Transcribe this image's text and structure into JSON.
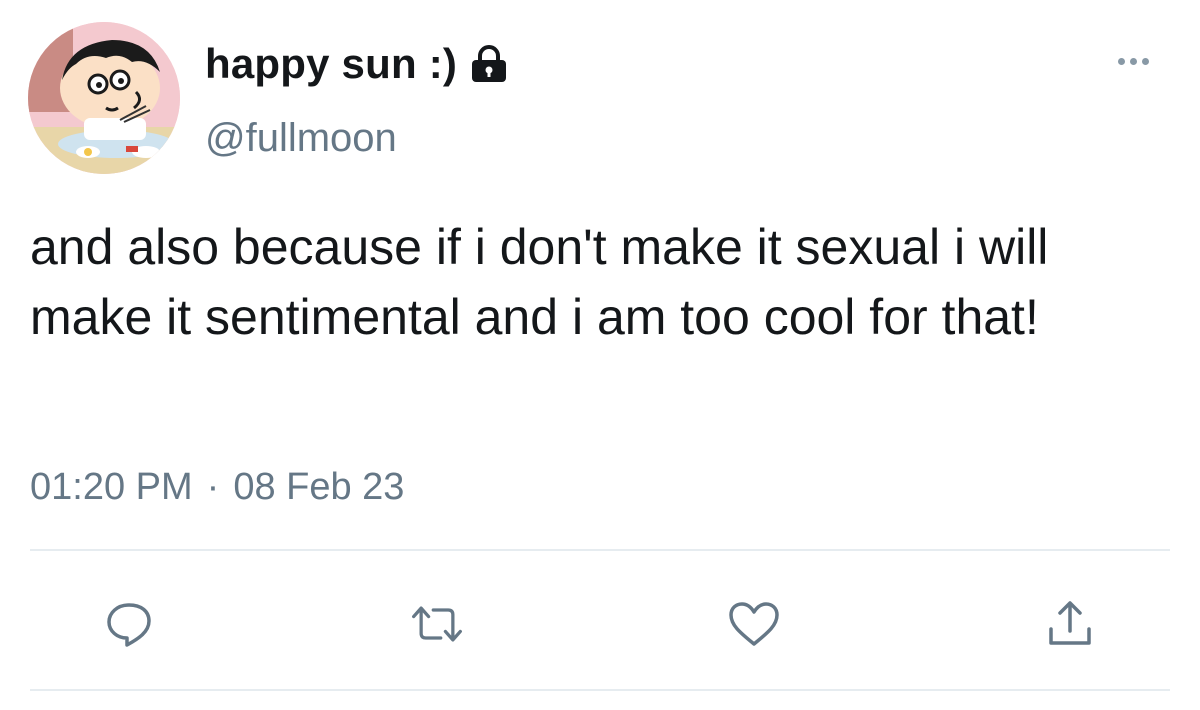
{
  "tweet": {
    "display_name": "happy sun :)",
    "handle": "@fullmoon",
    "text": "and also because if i don't make it sexual i will make it sentimental and i am too cool for that!",
    "time": "01:20 PM",
    "separator": "·",
    "date": "08 Feb 23",
    "protected": true
  },
  "icons": {
    "lock": "lock-icon",
    "more": "more-options-icon",
    "reply": "reply-icon",
    "retweet": "retweet-icon",
    "like": "like-icon",
    "share": "share-icon"
  },
  "colors": {
    "text": "#14171a",
    "secondary": "#657786",
    "icon": "#657786",
    "divider": "#e6ecf0",
    "avatar_bg": "#f4c9cf"
  }
}
